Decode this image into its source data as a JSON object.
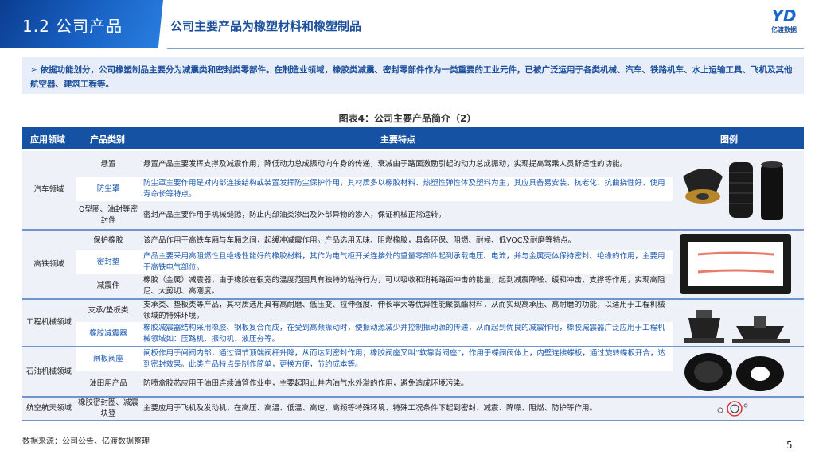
{
  "header": {
    "section": "1.2 公司产品",
    "title": "公司主要产品为橡塑材料和橡塑制品",
    "logo_text": "亿渡数据"
  },
  "intro": "➢ 依据功能划分，公司橡塑制品主要分为减震类和密封类零部件。在制造业领域，橡胶类减震、密封零部件作为一类重要的工业元件，已被广泛运用于各类机械、汽车、铁路机车、水上运输工具、飞机及其他航空器、建筑工程等。",
  "caption": "图表4：公司主要产品简介（2）",
  "table": {
    "headers": [
      "应用领域",
      "产品类别",
      "主要特点",
      "图例"
    ],
    "domains": [
      {
        "name": "汽车领域",
        "rows": [
          {
            "category": "悬置",
            "feature": "悬置产品主要发挥支撑及减震作用，降低动力总成振动向车身的传递，衰减由于路面激励引起的动力总成振动，实现提高驾乘人员舒适性的功能。"
          },
          {
            "category": "防尘罩",
            "feature": "防尘罩主要作用是对内部连接结构或装置发挥防尘保护作用，其材质多以橡胶材料、热塑性弹性体及塑料为主，其应具备易安装、抗老化、抗曲挠性好、使用寿命长等特点。"
          },
          {
            "category": "O型圈、油封等密封件",
            "feature": "密封产品主要作用于机械缝隙，防止内部油类渗出及外部异物的渗入，保证机械正常运转。"
          }
        ]
      },
      {
        "name": "高铁领域",
        "rows": [
          {
            "category": "保护橡胶",
            "feature": "该产品作用于高铁车厢与车厢之间，起缓冲减震作用。产品选用无味、阻燃橡胶，具备环保、阻燃、耐候、低VOC及耐磨等特点。"
          },
          {
            "category": "密封垫",
            "feature": "产品主要采用高阻燃性且绝缘性能好的橡胶材料，其作为电气柜开关连接处的重量零部件起到承载电压、电流，并与金属壳体保持密封、绝缘的作用，主要用于高铁电气部位。"
          },
          {
            "category": "减震件",
            "feature": "橡胶（金属）减震器，由于橡胶在很宽的温度范围具有独特的粘弹行为，可以吸收和消耗路面冲击的能量，起到减震降噪、缓和冲击、支撑等作用，实现高阻尼、大剪切、高刚度。"
          }
        ]
      },
      {
        "name": "工程机械领域",
        "rows": [
          {
            "category": "支承/垫板类",
            "feature": "支承类、垫板类等产品，其材质选用具有高耐磨、低压变、拉伸强度、伸长率大等优异性能聚氨酯材料，从而实现高承压、高耐磨的功能，以适用于工程机械领域的特殊环境。"
          },
          {
            "category": "橡胶减震器",
            "feature": "橡胶减震器结构采用橡胶、钢板复合而成，在受到高频振动时，使振动源减少并控制振动源的传递，从而起到优良的减震作用，橡胶减震器广泛应用于工程机械领域如：压路机、振动机、液压夯等。"
          }
        ]
      },
      {
        "name": "石油机械领域",
        "rows": [
          {
            "category": "闸板阀座",
            "feature": "闸板作用于闸阀内部，通过调节顶端阀杆升降，从而达到密封作用；橡胶阀座又叫“软靠背阀座”，作用于蝶阀阀体上，内壁连接蝶板，通过旋转蝶板开合，达到密封效果。此类产品特点是制作简单，更换方便，节约成本等。"
          },
          {
            "category": "油田用产品",
            "feature": "防喷盒胶芯应用于油田连续油管作业中，主要起阻止井内油气水外溢的作用，避免造成环境污染。"
          }
        ]
      },
      {
        "name": "航空航天领域",
        "rows": [
          {
            "category": "橡胶密封圈、减震块登",
            "feature": "主要应用于飞机及发动机，在高压、高温、低温、高速、高频等特殊环境、特殊工况条件下起到密封、减震、降噪、阻燃、防护等作用。"
          }
        ]
      }
    ]
  },
  "footer": {
    "source": "数据来源：公司公告、亿渡数据整理",
    "page": "5"
  },
  "colors": {
    "header_blue": "#1652a3",
    "accent_text": "#1b58b0",
    "intro_bg": "#e8eef9"
  }
}
